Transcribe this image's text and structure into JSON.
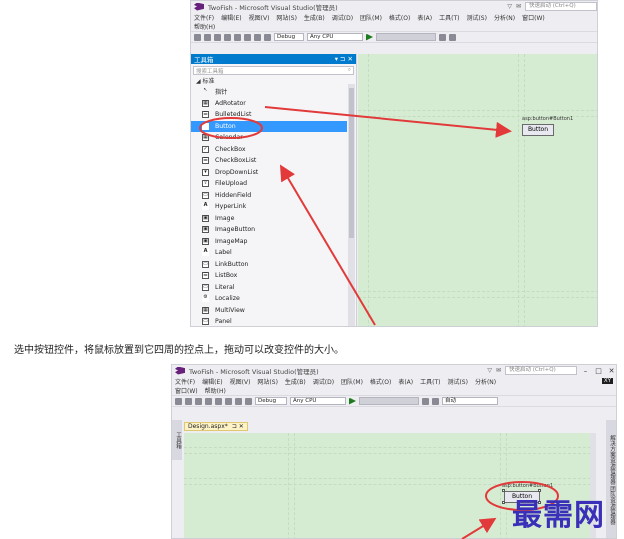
{
  "top": {
    "title": "TwoFish - Microsoft Visual Studio(管理员)",
    "quick_launch": "快速启动 (Ctrl+Q)",
    "menus": [
      "文件(F)",
      "编辑(E)",
      "视图(V)",
      "网站(S)",
      "生成(B)",
      "调试(D)",
      "团队(M)",
      "格式(O)",
      "表(A)",
      "工具(T)",
      "测试(S)",
      "分析(N)",
      "窗口(W)"
    ],
    "help_menu": "帮助(H)",
    "config": "Debug",
    "platform": "Any CPU",
    "toolbox_title": "工具箱",
    "toolbox_pin": "▾ ⊐ ✕",
    "search_placeholder": "搜索工具箱",
    "group": "◢ 标准",
    "items": [
      {
        "icon": "pointer-icon",
        "glyph": "↖",
        "label": "指针"
      },
      {
        "icon": "adrotator-icon",
        "glyph": "▦",
        "label": "AdRotator"
      },
      {
        "icon": "bulletedlist-icon",
        "glyph": "☰",
        "label": "BulletedList"
      },
      {
        "icon": "button-icon",
        "glyph": "ab",
        "label": "Button"
      },
      {
        "icon": "calendar-icon",
        "glyph": "▦",
        "label": "Calendar"
      },
      {
        "icon": "checkbox-icon",
        "glyph": "✓",
        "label": "CheckBox"
      },
      {
        "icon": "checkboxlist-icon",
        "glyph": "☰",
        "label": "CheckBoxList"
      },
      {
        "icon": "dropdownlist-icon",
        "glyph": "▾",
        "label": "DropDownList"
      },
      {
        "icon": "fileupload-icon",
        "glyph": "⇪",
        "label": "FileUpload"
      },
      {
        "icon": "hiddenfield-icon",
        "glyph": "▭",
        "label": "HiddenField"
      },
      {
        "icon": "hyperlink-icon",
        "glyph": "A",
        "label": "HyperLink"
      },
      {
        "icon": "image-icon",
        "glyph": "▣",
        "label": "Image"
      },
      {
        "icon": "imagebutton-icon",
        "glyph": "▣",
        "label": "ImageButton"
      },
      {
        "icon": "imagemap-icon",
        "glyph": "▣",
        "label": "ImageMap"
      },
      {
        "icon": "label-icon",
        "glyph": "A",
        "label": "Label"
      },
      {
        "icon": "linkbutton-icon",
        "glyph": "▭",
        "label": "LinkButton"
      },
      {
        "icon": "listbox-icon",
        "glyph": "☰",
        "label": "ListBox"
      },
      {
        "icon": "literal-icon",
        "glyph": "▭",
        "label": "Literal"
      },
      {
        "icon": "localize-icon",
        "glyph": "⚙",
        "label": "Localize"
      },
      {
        "icon": "multiview-icon",
        "glyph": "▦",
        "label": "MultiView"
      },
      {
        "icon": "panel-icon",
        "glyph": "▭",
        "label": "Panel"
      }
    ],
    "control_tag": "asp:button#Button1",
    "control_label": "Button"
  },
  "caption": "选中按钮控件，将鼠标放置到它四周的控点上，拖动可以改变控件的大小。",
  "bottom": {
    "title": "TwoFish - Microsoft Visual Studio(管理员)",
    "quick_launch": "快速启动 (Ctrl+Q)",
    "menus": [
      "文件(F)",
      "编辑(E)",
      "视图(V)",
      "网站(S)",
      "生成(B)",
      "调试(D)",
      "团队(M)",
      "格式(O)",
      "表(A)",
      "工具(T)",
      "测试(S)",
      "分析(N)"
    ],
    "menus2": [
      "窗口(W)",
      "帮助(H)"
    ],
    "config": "Debug",
    "platform": "Any CPU",
    "zoom": "自动",
    "doc_tab": "Design.aspx*",
    "doc_tab_icons": "⊐ ✕",
    "left_tab": "工具箱",
    "right_tab": "解决方案资源管理器 团队资源管理器",
    "control_tag": "asp:button#Button1",
    "control_label": "Button",
    "user_badge": "XY"
  },
  "watermark": "最需网"
}
